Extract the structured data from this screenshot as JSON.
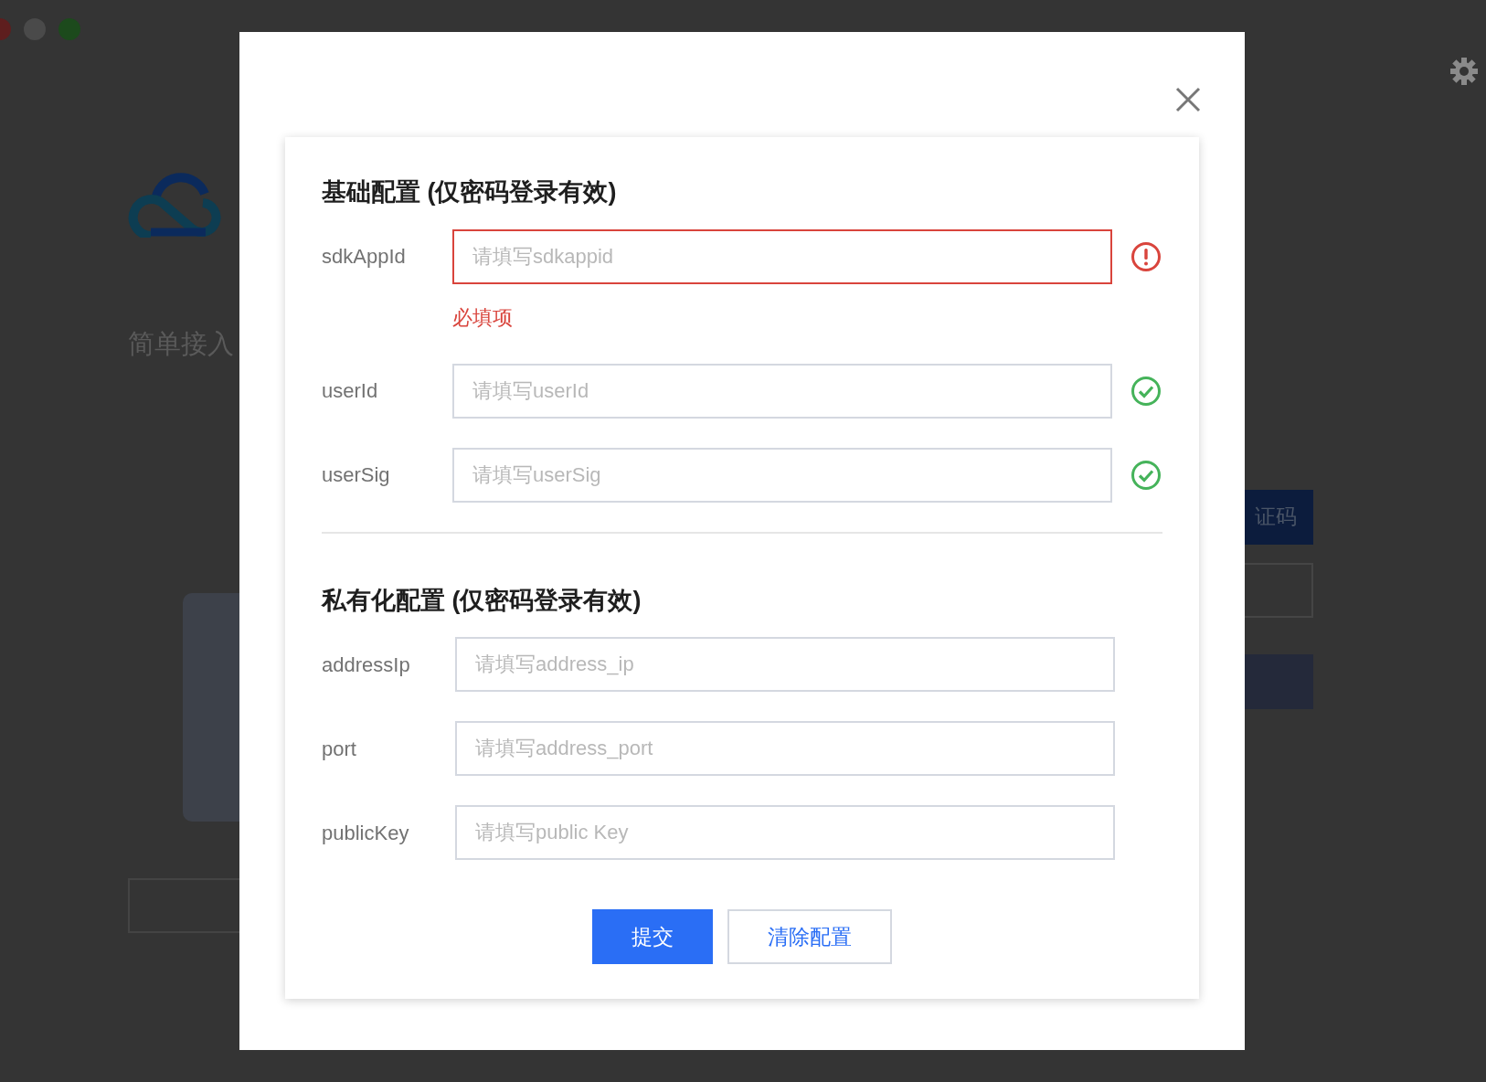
{
  "background": {
    "heading": "简单接入",
    "button_text": "证码"
  },
  "dialog": {
    "sections": [
      {
        "title": "基础配置 (仅密码登录有效)",
        "fields": [
          {
            "label": "sdkAppId",
            "placeholder": "请填写sdkappid",
            "valid": false,
            "message": "必填项"
          },
          {
            "label": "userId",
            "placeholder": "请填写userId",
            "valid": true
          },
          {
            "label": "userSig",
            "placeholder": "请填写userSig",
            "valid": true
          }
        ]
      },
      {
        "title": "私有化配置 (仅密码登录有效)",
        "fields": [
          {
            "label": "addressIp",
            "placeholder": "请填写address_ip"
          },
          {
            "label": "port",
            "placeholder": "请填写address_port"
          },
          {
            "label": "publicKey",
            "placeholder": "请填写public Key"
          }
        ]
      }
    ],
    "buttons": [
      {
        "label": "提交",
        "kind": "primary"
      },
      {
        "label": "清除配置",
        "kind": "secondary"
      }
    ]
  }
}
